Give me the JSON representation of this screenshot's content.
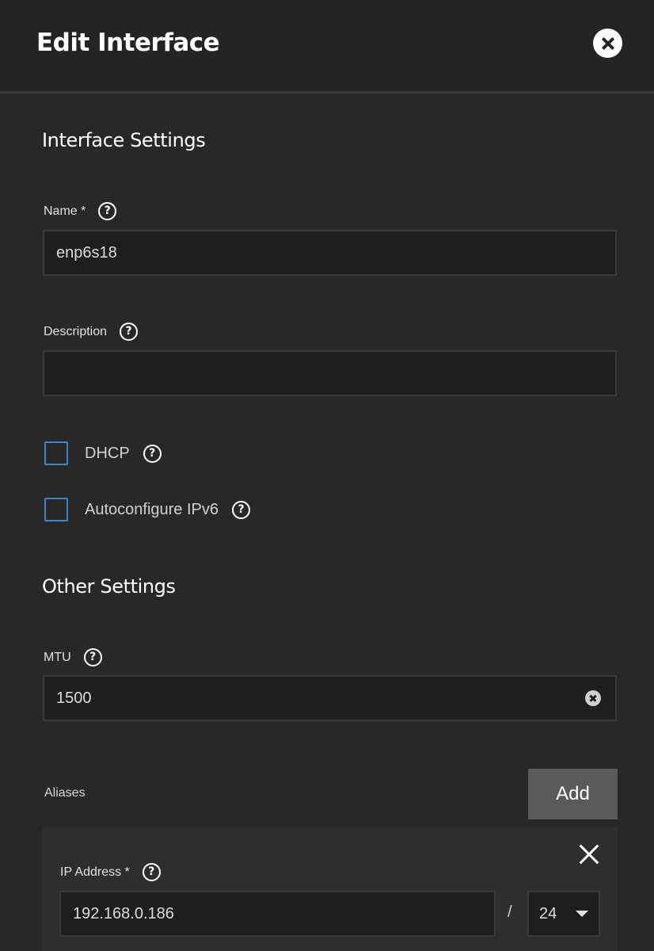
{
  "header": {
    "title": "Edit Interface"
  },
  "interface_settings": {
    "title": "Interface Settings",
    "name": {
      "label": "Name *",
      "value": "enp6s18"
    },
    "description": {
      "label": "Description",
      "value": ""
    },
    "dhcp": {
      "label": "DHCP",
      "checked": false
    },
    "autoconfigure_ipv6": {
      "label": "Autoconfigure IPv6",
      "checked": false
    }
  },
  "other_settings": {
    "title": "Other Settings",
    "mtu": {
      "label": "MTU",
      "value": "1500"
    }
  },
  "aliases": {
    "label": "Aliases",
    "add_label": "Add",
    "items": [
      {
        "ip_label": "IP Address *",
        "ip_value": "192.168.0.186",
        "separator": "/",
        "netmask": "24"
      }
    ]
  },
  "icons": {
    "help": "?",
    "close": "close-icon",
    "clear": "clear-icon",
    "remove": "remove-icon",
    "caret": "chevron-down-icon"
  },
  "colors": {
    "background": "#282828",
    "header": "#242424",
    "input": "#1e1e1e",
    "checkbox_border": "#3f85c8",
    "button": "#5a5a5a"
  }
}
